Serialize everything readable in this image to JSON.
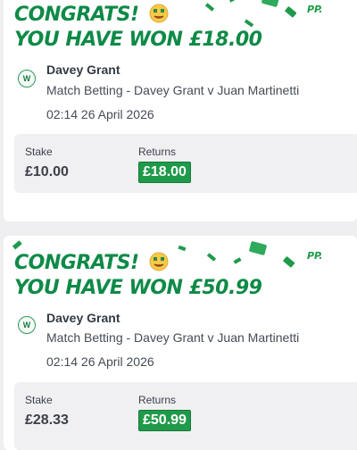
{
  "cards": [
    {
      "congrats": "CONGRATS!",
      "headline": "YOU HAVE WON £18.00",
      "badge": "W",
      "selection": "Davey Grant",
      "market": "Match Betting - Davey Grant v Juan Martinetti",
      "datetime": "02:14 26 April 2026",
      "stake_label": "Stake",
      "stake_value": "£10.00",
      "returns_label": "Returns",
      "returns_value": "£18.00",
      "brand_mark": "PP."
    },
    {
      "congrats": "CONGRATS!",
      "headline": "YOU HAVE WON £50.99",
      "badge": "W",
      "selection": "Davey Grant",
      "market": "Match Betting - Davey Grant v Juan Martinetti",
      "datetime": "02:14 26 April 2026",
      "stake_label": "Stake",
      "stake_value": "£28.33",
      "returns_label": "Returns",
      "returns_value": "£50.99",
      "brand_mark": "PP."
    }
  ],
  "icons": {
    "emoji": "money-mouth-face-icon",
    "confetti": "banknote-confetti-icon"
  },
  "colors": {
    "brand_green": "#0e8a47",
    "returns_green": "#1f9a4a",
    "box_grey": "#f0f0f3"
  }
}
